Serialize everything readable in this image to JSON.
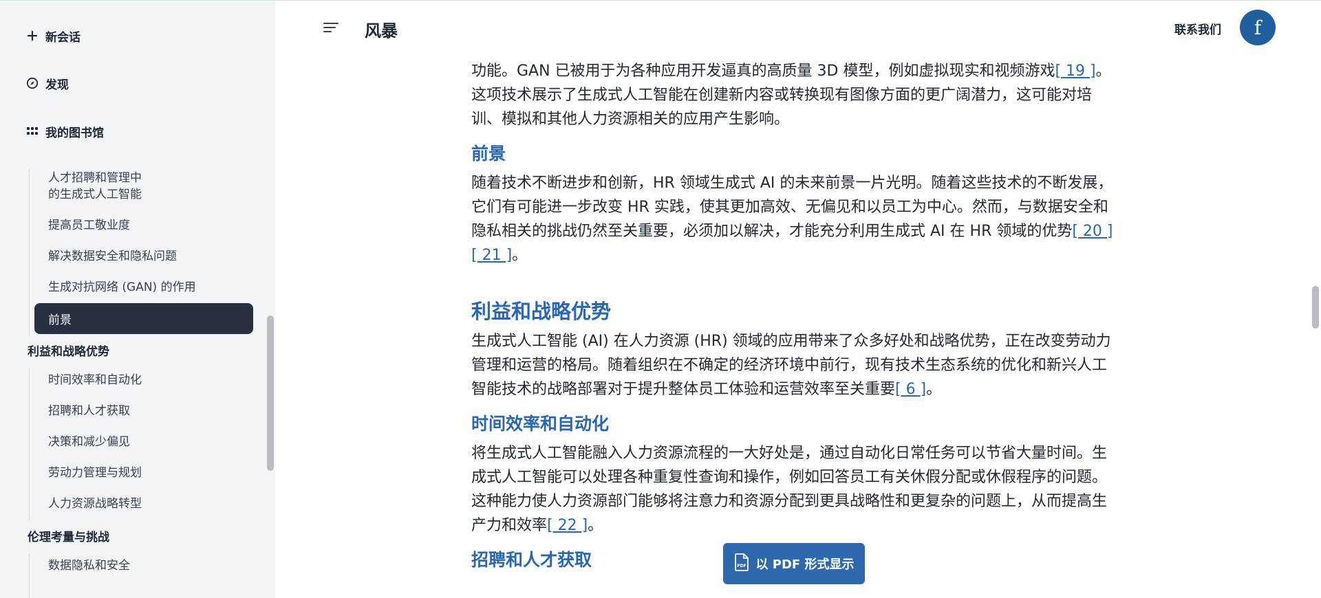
{
  "header": {
    "title": "风暴",
    "contact_label": "联系我们",
    "avatar_letter": "f"
  },
  "sidebar": {
    "new_chat": "新会话",
    "discover": "发现",
    "library": "我的图书馆",
    "toc_group1": [
      "人才招聘和管理中\n的生成式人工智能",
      "提高员工敬业度",
      "解决数据安全和隐私问题",
      "生成对抗网络 (GAN) 的作用"
    ],
    "toc_active": "前景",
    "section2": "利益和战略优势",
    "toc_group2": [
      "时间效率和自动化",
      "招聘和人才获取",
      "决策和减少偏见",
      "劳动力管理与规划",
      "人力资源战略转型"
    ],
    "section3": "伦理考量与挑战",
    "toc_group3": [
      "数据隐私和安全"
    ]
  },
  "content": {
    "intro_text": "功能。GAN 已被用于为各种应用开发逼真的高质量 3D 模型，例如虚拟现实和视频游戏",
    "intro_cite": "[ 19 ]",
    "intro_text2": "。这项技术展示了生成式人工智能在创建新内容或转换现有图像方面的更广阔潜力，这可能对培训、模拟和其他人力资源相关的应用产生影响。",
    "h_prospect": "前景",
    "prospect_text": "随着技术不断进步和创新，HR 领域生成式 AI 的未来前景一片光明。随着这些技术的不断发展，它们有可能进一步改变 HR 实践，使其更加高效、无偏见和以员工为中心。然而，与数据安全和隐私相关的挑战仍然至关重要，必须加以解决，才能充分利用生成式 AI 在 HR 领域的优势",
    "prospect_cite1": "[ 20 ]",
    "prospect_cite2": "[ 21 ]",
    "prospect_end": "。",
    "h_benefits": "利益和战略优势",
    "benefits_text": "生成式人工智能 (AI) 在人力资源 (HR) 领域的应用带来了众多好处和战略优势，正在改变劳动力管理和运营的格局。随着组织在不确定的经济环境中前行，现有技术生态系统的优化和新兴人工智能技术的战略部署对于提升整体员工体验和运营效率至关重要",
    "benefits_cite": "[ 6 ]",
    "benefits_end": "。",
    "h_time": "时间效率和自动化",
    "time_text": "将生成式人工智能融入人力资源流程的一大好处是，通过自动化日常任务可以节省大量时间。生成式人工智能可以处理各种重复性查询和操作，例如回答员工有关休假分配或休假程序的问题。这种能力使人力资源部门能够将注意力和资源分配到更具战略性和更复杂的问题上，从而提高生产力和效率",
    "time_cite": "[ 22 ]",
    "time_end": "。",
    "h_recruit": "招聘和人才获取"
  },
  "pdf_button": {
    "label": "以 PDF 形式显示",
    "icon_text": "PDF"
  },
  "colors": {
    "accent": "#2a67b2",
    "sidebar_bg": "#f3f4f6",
    "active_item_bg": "#273142",
    "avatar_bg": "#1f5f9e",
    "pdf_button_bg": "#2f69ad"
  }
}
